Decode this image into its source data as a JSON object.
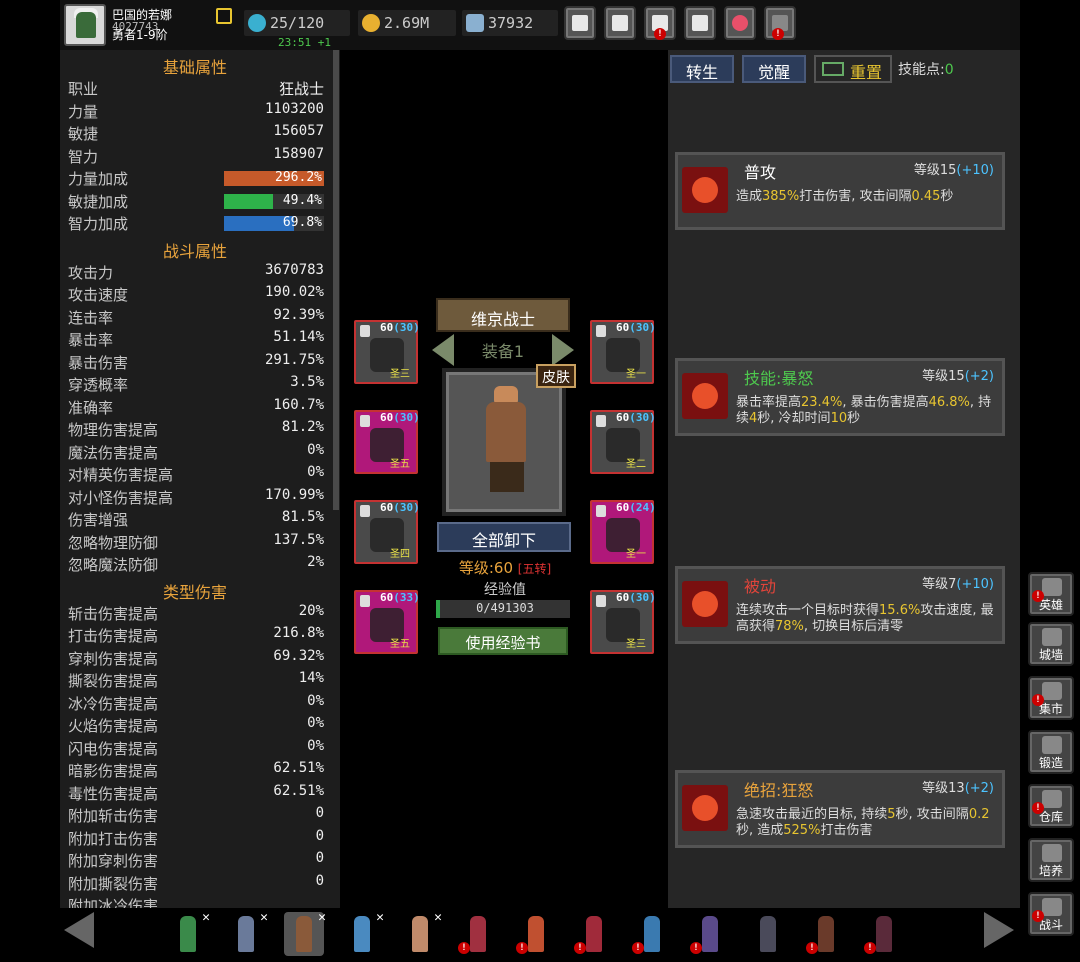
{
  "player": {
    "name": "巴国的若娜",
    "id": "4027743",
    "rank": "勇者1-9阶"
  },
  "resources": {
    "energy": "25/120",
    "timer": "23:51 +1",
    "gold": "2.69M",
    "gems": "37932"
  },
  "top_buttons": [
    "shop-cart",
    "mail",
    "gamepad",
    "settings",
    "color-wheel",
    "fireworks"
  ],
  "stats": {
    "basic_title": "基础属性",
    "basic": [
      {
        "k": "职业",
        "v": "狂战士"
      },
      {
        "k": "力量",
        "v": "1103200"
      },
      {
        "k": "敏捷",
        "v": "156057"
      },
      {
        "k": "智力",
        "v": "158907"
      }
    ],
    "bonus": [
      {
        "k": "力量加成",
        "v": "296.2%",
        "pct": 1.0,
        "color": "#c65a2a"
      },
      {
        "k": "敏捷加成",
        "v": "49.4%",
        "pct": 0.494,
        "color": "#2eb34a"
      },
      {
        "k": "智力加成",
        "v": "69.8%",
        "pct": 0.698,
        "color": "#2a6fc0"
      }
    ],
    "combat_title": "战斗属性",
    "combat": [
      {
        "k": "攻击力",
        "v": "3670783"
      },
      {
        "k": "攻击速度",
        "v": "190.02%"
      },
      {
        "k": "连击率",
        "v": "92.39%"
      },
      {
        "k": "暴击率",
        "v": "51.14%"
      },
      {
        "k": "暴击伤害",
        "v": "291.75%"
      },
      {
        "k": "穿透概率",
        "v": "3.5%"
      },
      {
        "k": "准确率",
        "v": "160.7%"
      },
      {
        "k": "物理伤害提高",
        "v": "81.2%"
      },
      {
        "k": "魔法伤害提高",
        "v": "0%"
      },
      {
        "k": "对精英伤害提高",
        "v": "0%"
      },
      {
        "k": "对小怪伤害提高",
        "v": "170.99%"
      },
      {
        "k": "伤害增强",
        "v": "81.5%"
      },
      {
        "k": "忽略物理防御",
        "v": "137.5%"
      },
      {
        "k": "忽略魔法防御",
        "v": "2%"
      }
    ],
    "type_title": "类型伤害",
    "type": [
      {
        "k": "斩击伤害提高",
        "v": "20%"
      },
      {
        "k": "打击伤害提高",
        "v": "216.8%"
      },
      {
        "k": "穿刺伤害提高",
        "v": "69.32%"
      },
      {
        "k": "撕裂伤害提高",
        "v": "14%"
      },
      {
        "k": "冰冷伤害提高",
        "v": "0%"
      },
      {
        "k": "火焰伤害提高",
        "v": "0%"
      },
      {
        "k": "闪电伤害提高",
        "v": "0%"
      },
      {
        "k": "暗影伤害提高",
        "v": "62.51%"
      },
      {
        "k": "毒性伤害提高",
        "v": "62.51%"
      },
      {
        "k": "附加斩击伤害",
        "v": "0"
      },
      {
        "k": "附加打击伤害",
        "v": "0"
      },
      {
        "k": "附加穿刺伤害",
        "v": "0"
      },
      {
        "k": "附加撕裂伤害",
        "v": "0"
      },
      {
        "k": "附加冰冷伤害",
        "v": ""
      }
    ]
  },
  "hero": {
    "class_title": "维京战士",
    "equip_set": "装备1",
    "skin_label": "皮肤",
    "unequip_all": "全部卸下",
    "level_text": "等级:60",
    "rebirth_tag": "[五转]",
    "exp_label": "经验值",
    "exp_value": "0/491303",
    "exp_fraction": 0.0,
    "use_exp_book": "使用经验书"
  },
  "equipment": [
    {
      "lv": "60",
      "bonus": "(30)",
      "tier": "圣三",
      "style": "gray",
      "icon": "boots-icon"
    },
    {
      "lv": "60",
      "bonus": "(30)",
      "tier": "圣一",
      "style": "gray",
      "icon": "amulet-icon"
    },
    {
      "lv": "60",
      "bonus": "(30)",
      "tier": "圣五",
      "style": "purple",
      "icon": "armor-icon"
    },
    {
      "lv": "60",
      "bonus": "(30)",
      "tier": "圣二",
      "style": "gray",
      "icon": "gloves-icon"
    },
    {
      "lv": "60",
      "bonus": "(30)",
      "tier": "圣四",
      "style": "gray",
      "icon": "helmet-icon"
    },
    {
      "lv": "60",
      "bonus": "(24)",
      "tier": "圣一",
      "style": "purple",
      "icon": "ring-icon"
    },
    {
      "lv": "60",
      "bonus": "(33)",
      "tier": "圣五",
      "style": "purple",
      "icon": "shoulder-icon"
    },
    {
      "lv": "60",
      "bonus": "(30)",
      "tier": "圣三",
      "style": "gray",
      "icon": "hammer-icon"
    }
  ],
  "tabs": {
    "rebirth": "转生",
    "awaken": "觉醒",
    "reset": "重置",
    "skill_points_label": "技能点:",
    "skill_points": "0"
  },
  "skills": [
    {
      "name": "普攻",
      "name_color": "#ffffff",
      "level": "等级15",
      "plus": "(+10)",
      "desc": [
        "造成",
        "385%",
        "打击伤害, 攻击间隔",
        "0.45",
        "秒"
      ]
    },
    {
      "name": "技能:暴怒",
      "name_color": "#4ec94e",
      "level": "等级15",
      "plus": "(+2)",
      "desc": [
        "暴击率提高",
        "23.4%",
        ", 暴击伤害提高",
        "46.8%",
        ", 持续",
        "4",
        "秒, 冷却时间",
        "10",
        "秒"
      ]
    },
    {
      "name": "被动",
      "name_color": "#e0443a",
      "level": "等级7",
      "plus": "(+10)",
      "desc": [
        "连续攻击一个目标时获得",
        "15.6%",
        "攻击速度, 最高获得",
        "78%",
        ", 切换目标后清零"
      ]
    },
    {
      "name": "绝招:狂怒",
      "name_color": "#e8a33c",
      "level": "等级13",
      "plus": "(+2)",
      "desc": [
        "急速攻击最近的目标, 持续",
        "5",
        "秒, 攻击间隔",
        "0.2",
        "秒, 造成",
        "525%",
        "打击伤害"
      ]
    }
  ],
  "side_nav": [
    {
      "label": "英雄",
      "icon": "helmet-icon",
      "alert": true
    },
    {
      "label": "城墙",
      "icon": "castle-icon",
      "alert": false
    },
    {
      "label": "集市",
      "icon": "market-icon",
      "alert": true
    },
    {
      "label": "锻造",
      "icon": "anvil-icon",
      "alert": false
    },
    {
      "label": "仓库",
      "icon": "warehouse-icon",
      "alert": true
    },
    {
      "label": "培养",
      "icon": "trophy-icon",
      "alert": false
    },
    {
      "label": "战斗",
      "icon": "portal-icon",
      "alert": true
    }
  ],
  "hero_roster": [
    {
      "color": "#3a8a4a",
      "x": true,
      "alert": false
    },
    {
      "color": "#6a7a9a",
      "x": true,
      "alert": false
    },
    {
      "color": "#8a5a3a",
      "x": true,
      "alert": false,
      "selected": true
    },
    {
      "color": "#4a8ac0",
      "x": true,
      "alert": false
    },
    {
      "color": "#c08a6a",
      "x": true,
      "alert": false
    },
    {
      "color": "#a03040",
      "x": false,
      "alert": true
    },
    {
      "color": "#c05030",
      "x": false,
      "alert": true
    },
    {
      "color": "#a02a3a",
      "x": false,
      "alert": true
    },
    {
      "color": "#3a7ab0",
      "x": false,
      "alert": true
    },
    {
      "color": "#5a4a8a",
      "x": false,
      "alert": true
    },
    {
      "color": "#4a4a5a",
      "x": false,
      "alert": false
    },
    {
      "color": "#6a3a2a",
      "x": false,
      "alert": true
    },
    {
      "color": "#5a2a3a",
      "x": false,
      "alert": true
    }
  ]
}
